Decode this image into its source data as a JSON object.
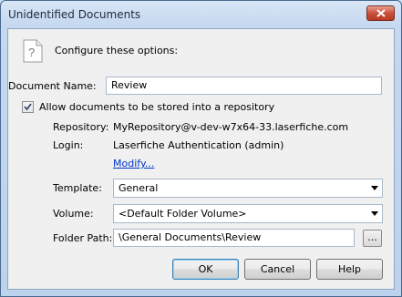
{
  "window": {
    "title": "Unidentified Documents"
  },
  "header": {
    "icon": "question-document-icon",
    "text": "Configure these options:"
  },
  "document_name": {
    "label": "Document Name:",
    "value": "Review"
  },
  "allow_repo": {
    "label": "Allow documents to be stored into a repository",
    "checked": true
  },
  "repository": {
    "label": "Repository:",
    "value": "MyRepository@v-dev-w7x64-33.laserfiche.com"
  },
  "login": {
    "label": "Login:",
    "value": "Laserfiche Authentication (admin)",
    "modify_link": "Modify..."
  },
  "template": {
    "label": "Template:",
    "value": "General"
  },
  "volume": {
    "label": "Volume:",
    "value": "<Default Folder Volume>"
  },
  "folder_path": {
    "label": "Folder Path:",
    "value": "\\General Documents\\Review",
    "browse_label": "..."
  },
  "buttons": {
    "ok": "OK",
    "cancel": "Cancel",
    "help": "Help"
  }
}
